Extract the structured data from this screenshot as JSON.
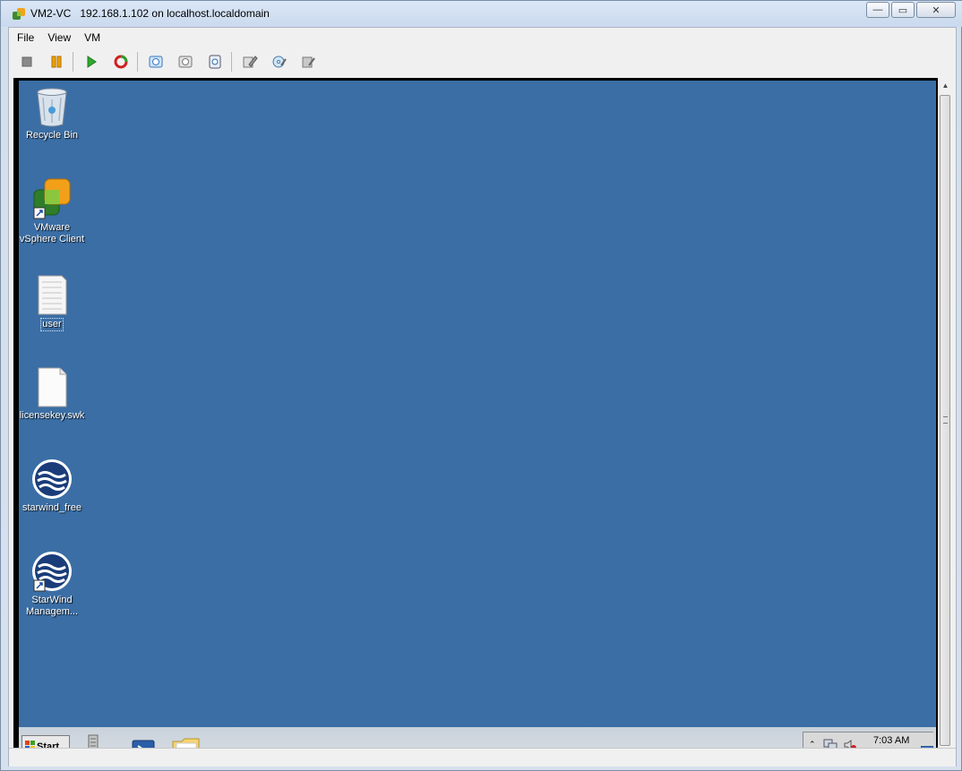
{
  "window": {
    "title": "VM2-VC   192.168.1.102 on localhost.localdomain",
    "minimize_label": "—",
    "maximize_label": "▭",
    "close_label": "✕"
  },
  "menu": [
    "File",
    "View",
    "VM"
  ],
  "toolbar": {
    "icons": [
      "power-off-icon",
      "pause-icon",
      "power-on-icon",
      "reset-icon",
      "snapshot-icon",
      "revert-snapshot-icon",
      "snapshot-manager-icon",
      "edit-settings-icon",
      "connect-cd-icon",
      "connect-floppy-icon"
    ]
  },
  "desktop": {
    "background": "#3a6ea5",
    "icons": [
      {
        "label": "Recycle Bin",
        "icon": "recycle-bin-icon"
      },
      {
        "label": "VMware\nvSphere Client",
        "icon": "vsphere-client-icon"
      },
      {
        "label": "user",
        "icon": "text-file-icon",
        "selected": true
      },
      {
        "label": "licensekey.swk",
        "icon": "blank-file-icon"
      },
      {
        "label": "starwind_free",
        "icon": "starwind-icon"
      },
      {
        "label": "StarWind\nManagem...",
        "icon": "starwind-management-icon"
      }
    ]
  },
  "taskbar": {
    "start_label": "Start",
    "clock": "7:03 AM"
  }
}
